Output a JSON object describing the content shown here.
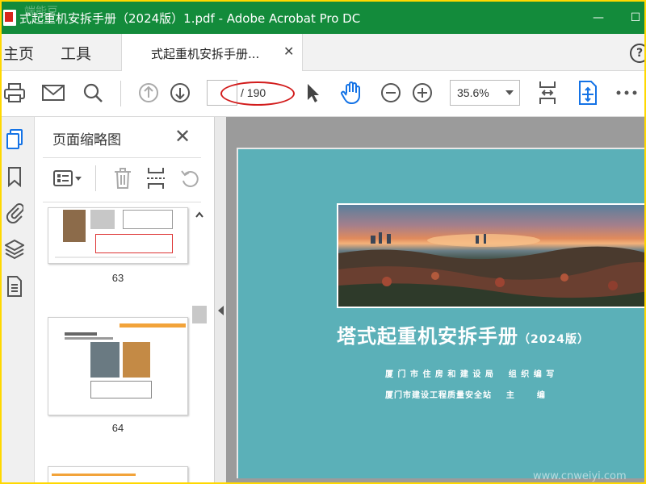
{
  "window": {
    "title": "式起重机安拆手册（2024版）1.pdf - Adobe Acrobat Pro DC",
    "minimize_glyph": "—",
    "maximize_glyph": "☐"
  },
  "menu": {
    "home": "主页",
    "tools": "工具",
    "help_glyph": "?"
  },
  "tab": {
    "label": "式起重机安拆手册...",
    "close_glyph": "✕"
  },
  "toolbar": {
    "page_current": "",
    "page_total": "/ 190",
    "zoom": "35.6%",
    "icons": [
      "print-icon",
      "mail-icon",
      "search-icon",
      "page-up-icon",
      "page-down-icon",
      "select-cursor-icon",
      "hand-icon",
      "zoom-out-icon",
      "zoom-in-icon",
      "zoom-dropdown-icon",
      "fit-page-icon",
      "scroll-mode-icon",
      "more-icon"
    ],
    "annotation_color": "#d21c1c"
  },
  "left_rail": {
    "icons": [
      "page-thumbnails-icon",
      "bookmark-icon",
      "attachment-icon",
      "layers-icon",
      "document-icon"
    ]
  },
  "thumbnails": {
    "title": "页面缩略图",
    "close_glyph": "✕",
    "pages": [
      {
        "label": "63"
      },
      {
        "label": "64"
      }
    ],
    "tools": [
      "thumbnail-options-icon",
      "delete-icon",
      "insert-page-icon",
      "rotate-icon"
    ]
  },
  "cover": {
    "title": "塔式起重机安拆手册",
    "edition": "（2024版）",
    "line1": "厦 门 市 住 房 和 建 设 局    组 织 编 写",
    "line2": "厦门市建设工程质量安全站    主      编",
    "background": "#5bb0b8"
  },
  "watermark": {
    "top_left": "端能豆",
    "bottom_right": "www.cnweiyi.com"
  },
  "colors": {
    "titlebar": "#138b3b",
    "frame": "#ffd800"
  }
}
